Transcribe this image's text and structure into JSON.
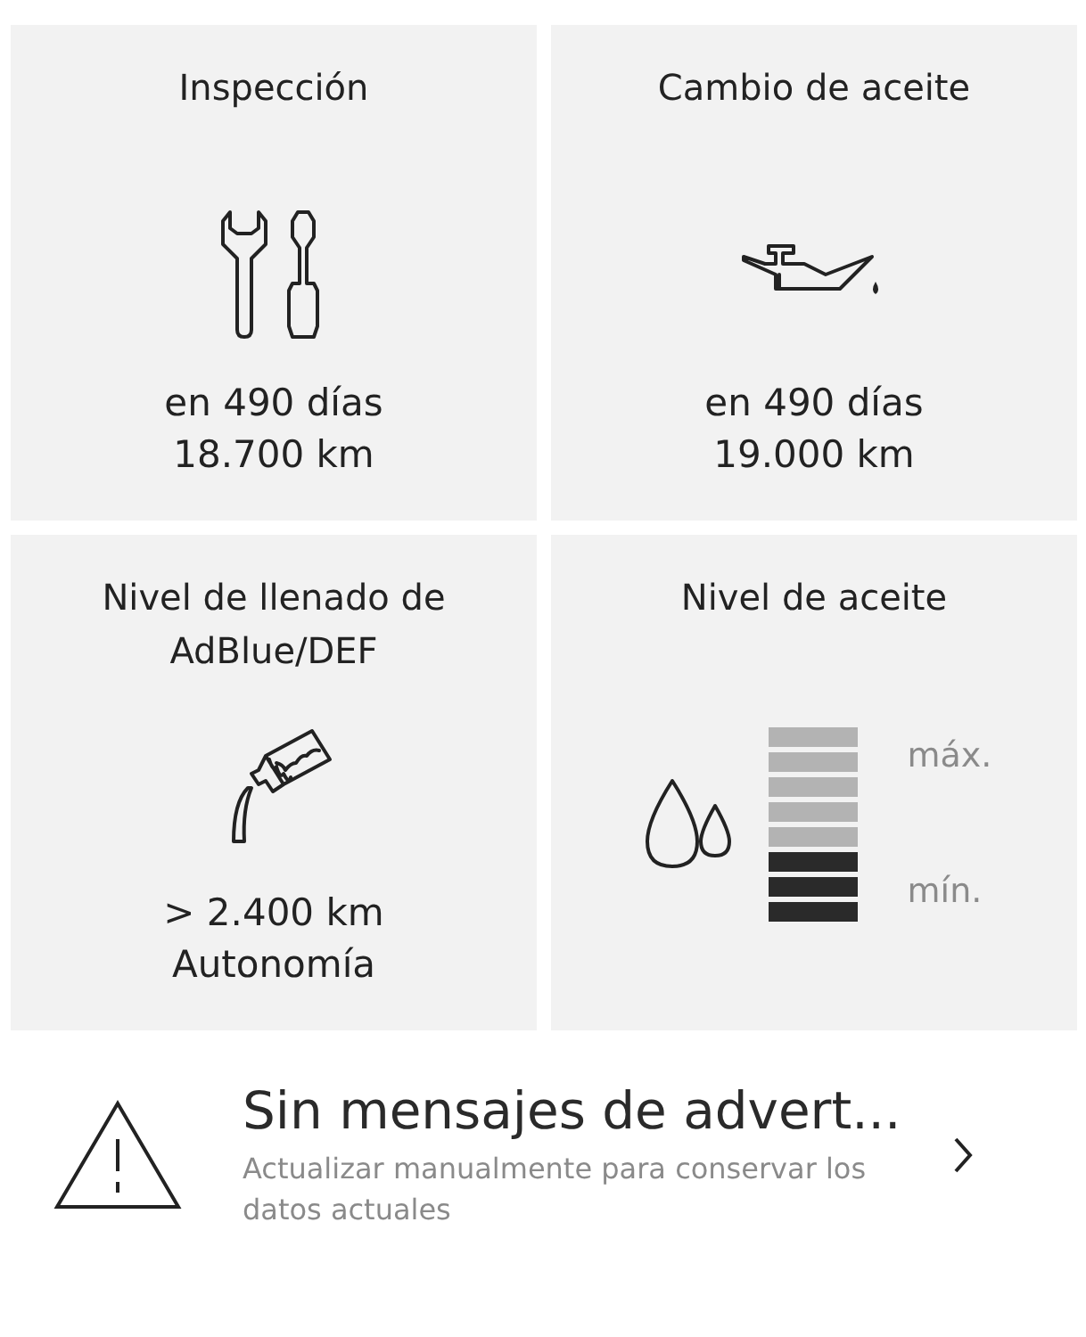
{
  "tiles": [
    {
      "kind": "inspection",
      "title": "Inspección",
      "lines": [
        "en 490 días",
        "18.700 km"
      ]
    },
    {
      "kind": "oil-change",
      "title": "Cambio de aceite",
      "lines": [
        "en 490 días",
        "19.000 km"
      ]
    },
    {
      "kind": "adblue",
      "title": "Nivel de llenado de AdBlue/DEF",
      "lines": [
        "> 2.400 km",
        "Autonomía"
      ]
    },
    {
      "kind": "oil-level",
      "title": "Nivel de aceite",
      "level": 0.375,
      "max_label": "máx.",
      "min_label": "mín."
    }
  ],
  "warning": {
    "title": "Sin mensajes de advert...",
    "subtitle": "Actualizar manualmente para conservar los datos actuales"
  }
}
